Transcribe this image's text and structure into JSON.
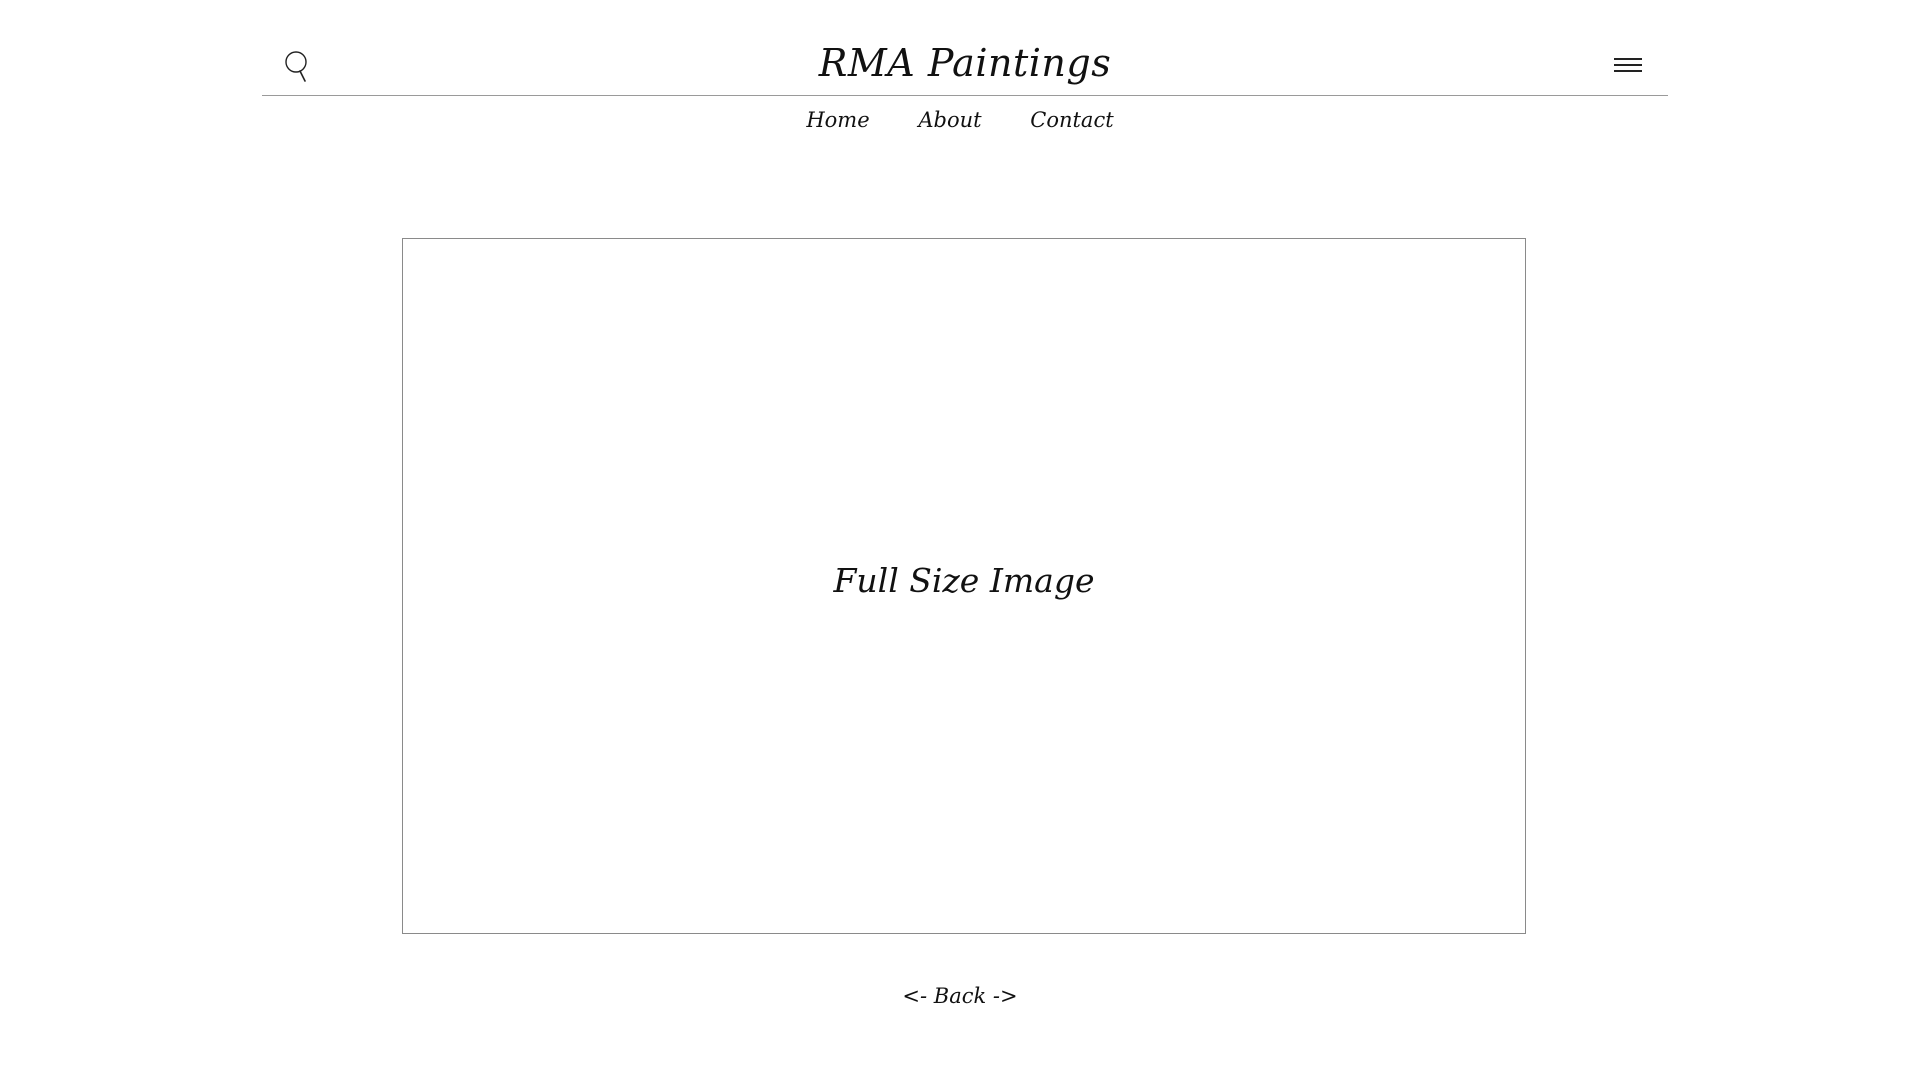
{
  "header": {
    "title": "RMA Paintings",
    "search_icon": "search-icon",
    "menu_icon": "hamburger-menu-icon"
  },
  "nav": {
    "items": [
      {
        "label": "Home"
      },
      {
        "label": "About"
      },
      {
        "label": "Contact"
      }
    ]
  },
  "main": {
    "image_placeholder_label": "Full Size Image"
  },
  "footer": {
    "back_label": "<- Back ->"
  },
  "colors": {
    "background": "#ffffff",
    "text": "#111111",
    "divider": "#9a9a9a",
    "frame_border": "#8a8a8a"
  }
}
